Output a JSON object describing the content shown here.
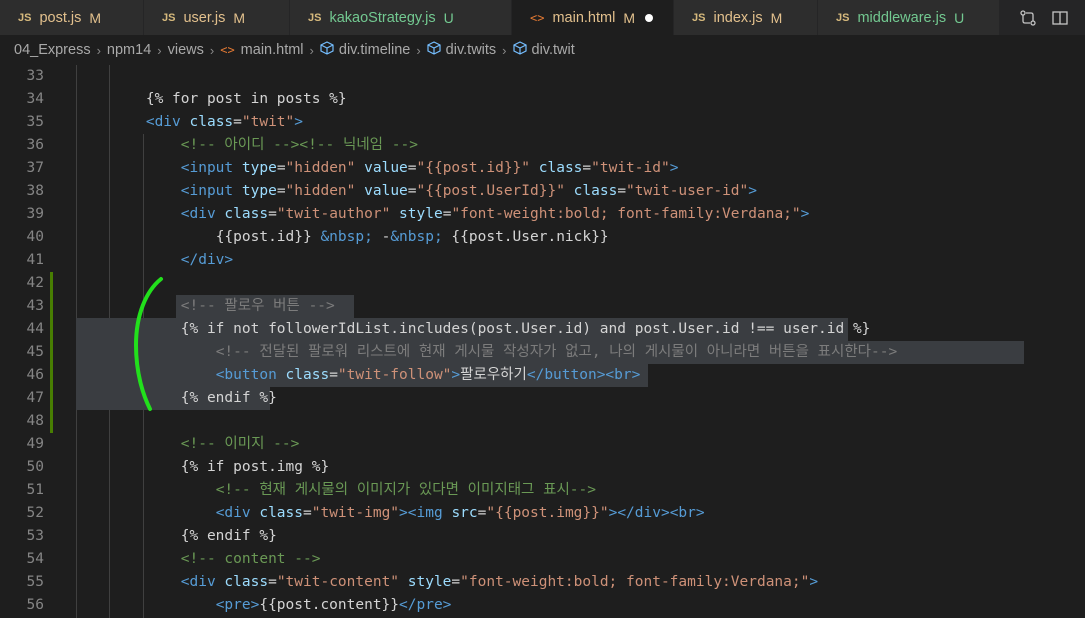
{
  "tabs": [
    {
      "icon": "JS",
      "name": "post.js",
      "status": "M",
      "kind": "m",
      "active": false
    },
    {
      "icon": "JS",
      "name": "user.js",
      "status": "M",
      "kind": "m",
      "active": false
    },
    {
      "icon": "JS",
      "name": "kakaoStrategy.js",
      "status": "U",
      "kind": "u",
      "active": false
    },
    {
      "icon": "<>",
      "name": "main.html",
      "status": "M",
      "kind": "m",
      "active": true
    },
    {
      "icon": "JS",
      "name": "index.js",
      "status": "M",
      "kind": "m",
      "active": false
    },
    {
      "icon": "JS",
      "name": "middleware.js",
      "status": "U",
      "kind": "u",
      "active": false
    }
  ],
  "breadcrumb": {
    "items": [
      "04_Express",
      "npm14",
      "views",
      "main.html",
      "div.timeline",
      "div.twits",
      "div.twit"
    ],
    "separator": "›"
  },
  "editor": {
    "lines": [
      {
        "n": "33",
        "segs": []
      },
      {
        "n": "34",
        "segs": [
          {
            "t": "        "
          },
          {
            "c": "tpl",
            "t": "{% for post in posts %}"
          }
        ]
      },
      {
        "n": "35",
        "segs": [
          {
            "t": "        "
          },
          {
            "c": "tag",
            "t": "<div"
          },
          {
            "t": " "
          },
          {
            "c": "attr",
            "t": "class"
          },
          {
            "t": "="
          },
          {
            "c": "str",
            "t": "\"twit\""
          },
          {
            "c": "tag",
            "t": ">"
          }
        ]
      },
      {
        "n": "36",
        "segs": [
          {
            "t": "            "
          },
          {
            "c": "com",
            "t": "<!-- 아이디 --><!-- 닉네임 -->"
          }
        ]
      },
      {
        "n": "37",
        "segs": [
          {
            "t": "            "
          },
          {
            "c": "tag",
            "t": "<input"
          },
          {
            "t": " "
          },
          {
            "c": "attr",
            "t": "type"
          },
          {
            "t": "="
          },
          {
            "c": "str",
            "t": "\"hidden\""
          },
          {
            "t": " "
          },
          {
            "c": "attr",
            "t": "value"
          },
          {
            "t": "="
          },
          {
            "c": "str",
            "t": "\"{{post.id}}\""
          },
          {
            "t": " "
          },
          {
            "c": "attr",
            "t": "class"
          },
          {
            "t": "="
          },
          {
            "c": "str",
            "t": "\"twit-id\""
          },
          {
            "c": "tag",
            "t": ">"
          }
        ]
      },
      {
        "n": "38",
        "segs": [
          {
            "t": "            "
          },
          {
            "c": "tag",
            "t": "<input"
          },
          {
            "t": " "
          },
          {
            "c": "attr",
            "t": "type"
          },
          {
            "t": "="
          },
          {
            "c": "str",
            "t": "\"hidden\""
          },
          {
            "t": " "
          },
          {
            "c": "attr",
            "t": "value"
          },
          {
            "t": "="
          },
          {
            "c": "str",
            "t": "\"{{post.UserId}}\""
          },
          {
            "t": " "
          },
          {
            "c": "attr",
            "t": "class"
          },
          {
            "t": "="
          },
          {
            "c": "str",
            "t": "\"twit-user-id\""
          },
          {
            "c": "tag",
            "t": ">"
          }
        ]
      },
      {
        "n": "39",
        "segs": [
          {
            "t": "            "
          },
          {
            "c": "tag",
            "t": "<div"
          },
          {
            "t": " "
          },
          {
            "c": "attr",
            "t": "class"
          },
          {
            "t": "="
          },
          {
            "c": "str",
            "t": "\"twit-author\""
          },
          {
            "t": " "
          },
          {
            "c": "attr",
            "t": "style"
          },
          {
            "t": "="
          },
          {
            "c": "str",
            "t": "\"font-weight:bold; font-family:Verdana;\""
          },
          {
            "c": "tag",
            "t": ">"
          }
        ]
      },
      {
        "n": "40",
        "segs": [
          {
            "t": "                "
          },
          {
            "c": "txt",
            "t": "{{post.id}} "
          },
          {
            "c": "ent",
            "t": "&nbsp;"
          },
          {
            "c": "txt",
            "t": " -"
          },
          {
            "c": "ent",
            "t": "&nbsp;"
          },
          {
            "c": "txt",
            "t": " {{post.User.nick}}"
          }
        ]
      },
      {
        "n": "41",
        "segs": [
          {
            "t": "            "
          },
          {
            "c": "tag",
            "t": "</div>"
          }
        ]
      },
      {
        "n": "42",
        "segs": []
      },
      {
        "n": "43",
        "segs": [
          {
            "t": "            "
          },
          {
            "c": "comsel",
            "t": "<!-- 팔로우 버튼 -->"
          }
        ]
      },
      {
        "n": "44",
        "segs": [
          {
            "t": "            "
          },
          {
            "c": "tpl",
            "t": "{% if not followerIdList.includes(post.User.id) and post.User.id !== user.id %}"
          }
        ]
      },
      {
        "n": "45",
        "segs": [
          {
            "t": "                "
          },
          {
            "c": "comsel",
            "t": "<!-- 전달된 팔로워 리스트에 현재 게시물 작성자가 없고, 나의 게시물이 아니라면 버튼을 표시한다-->"
          }
        ]
      },
      {
        "n": "46",
        "segs": [
          {
            "t": "                "
          },
          {
            "c": "tag",
            "t": "<button"
          },
          {
            "t": " "
          },
          {
            "c": "attr",
            "t": "class"
          },
          {
            "t": "="
          },
          {
            "c": "str",
            "t": "\"twit-follow\""
          },
          {
            "c": "tag",
            "t": ">"
          },
          {
            "c": "txt",
            "t": "팔로우하기"
          },
          {
            "c": "tag",
            "t": "</button><br>"
          }
        ]
      },
      {
        "n": "47",
        "segs": [
          {
            "t": "            "
          },
          {
            "c": "tpl",
            "t": "{% endif %}"
          }
        ]
      },
      {
        "n": "48",
        "segs": []
      },
      {
        "n": "49",
        "segs": [
          {
            "t": "            "
          },
          {
            "c": "com",
            "t": "<!-- 이미지 -->"
          }
        ]
      },
      {
        "n": "50",
        "segs": [
          {
            "t": "            "
          },
          {
            "c": "tpl",
            "t": "{% if post.img %}"
          }
        ]
      },
      {
        "n": "51",
        "segs": [
          {
            "t": "                "
          },
          {
            "c": "com",
            "t": "<!-- 현재 게시물의 이미지가 있다면 이미지태그 표시-->"
          }
        ]
      },
      {
        "n": "52",
        "segs": [
          {
            "t": "                "
          },
          {
            "c": "tag",
            "t": "<div"
          },
          {
            "t": " "
          },
          {
            "c": "attr",
            "t": "class"
          },
          {
            "t": "="
          },
          {
            "c": "str",
            "t": "\"twit-img\""
          },
          {
            "c": "tag",
            "t": "><img"
          },
          {
            "t": " "
          },
          {
            "c": "attr",
            "t": "src"
          },
          {
            "t": "="
          },
          {
            "c": "str",
            "t": "\"{{post.img}}\""
          },
          {
            "c": "tag",
            "t": "></div><br>"
          }
        ]
      },
      {
        "n": "53",
        "segs": [
          {
            "t": "            "
          },
          {
            "c": "tpl",
            "t": "{% endif %}"
          }
        ]
      },
      {
        "n": "54",
        "segs": [
          {
            "t": "            "
          },
          {
            "c": "com",
            "t": "<!-- content -->"
          }
        ]
      },
      {
        "n": "55",
        "segs": [
          {
            "t": "            "
          },
          {
            "c": "tag",
            "t": "<div"
          },
          {
            "t": " "
          },
          {
            "c": "attr",
            "t": "class"
          },
          {
            "t": "="
          },
          {
            "c": "str",
            "t": "\"twit-content\""
          },
          {
            "t": " "
          },
          {
            "c": "attr",
            "t": "style"
          },
          {
            "t": "="
          },
          {
            "c": "str",
            "t": "\"font-weight:bold; font-family:Verdana;\""
          },
          {
            "c": "tag",
            "t": ">"
          }
        ]
      },
      {
        "n": "56",
        "segs": [
          {
            "t": "                "
          },
          {
            "c": "tag",
            "t": "<pre>"
          },
          {
            "c": "txt",
            "t": "{{post.content}}"
          },
          {
            "c": "tag",
            "t": "</pre>"
          }
        ]
      }
    ]
  }
}
